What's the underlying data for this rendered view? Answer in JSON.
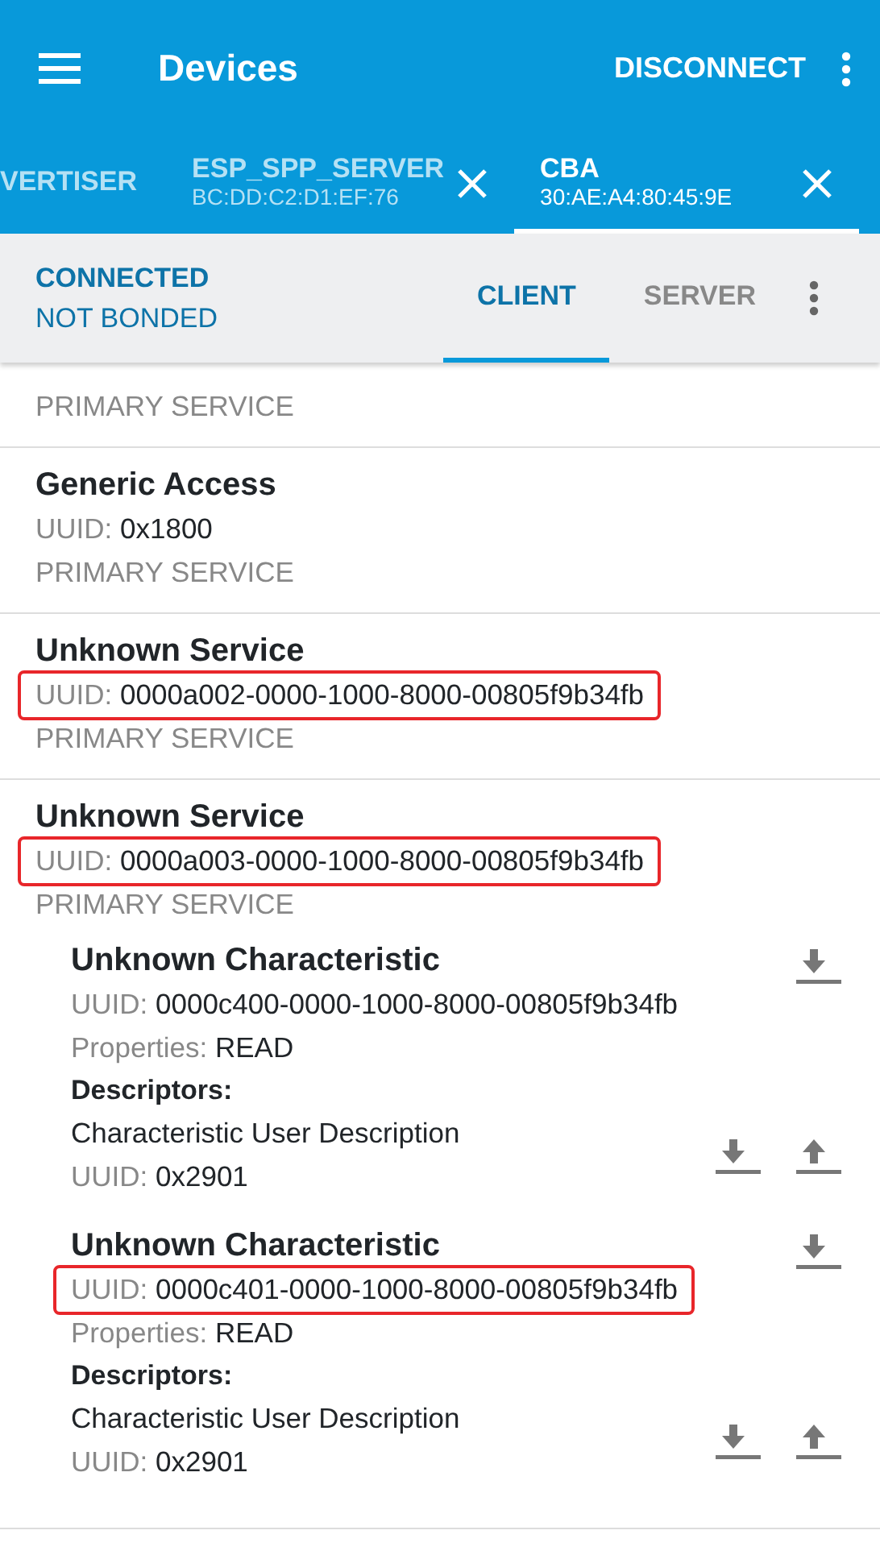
{
  "app_bar": {
    "title": "Devices",
    "action": "DISCONNECT"
  },
  "device_tabs": [
    {
      "name": "VERTISER",
      "selected": false
    },
    {
      "name": "ESP_SPP_SERVER",
      "address": "BC:DD:C2:D1:EF:76",
      "selected": false
    },
    {
      "name": "CBA",
      "address": "30:AE:A4:80:45:9E",
      "selected": true
    }
  ],
  "connection": {
    "state": "CONNECTED",
    "bond": "NOT BONDED"
  },
  "view_tabs": [
    {
      "label": "CLIENT",
      "selected": true
    },
    {
      "label": "SERVER",
      "selected": false
    }
  ],
  "services": [
    {
      "type": "PRIMARY SERVICE"
    },
    {
      "name": "Generic Access",
      "uuid_label": "UUID:",
      "uuid": "0x1800",
      "type": "PRIMARY SERVICE",
      "highlighted": false
    },
    {
      "name": "Unknown Service",
      "uuid_label": "UUID:",
      "uuid": "0000a002-0000-1000-8000-00805f9b34fb",
      "type": "PRIMARY SERVICE",
      "highlighted": true
    },
    {
      "name": "Unknown Service",
      "uuid_label": "UUID:",
      "uuid": "0000a003-0000-1000-8000-00805f9b34fb",
      "type": "PRIMARY SERVICE",
      "highlighted": true,
      "characteristics": [
        {
          "name": "Unknown Characteristic",
          "uuid_label": "UUID:",
          "uuid": "0000c400-0000-1000-8000-00805f9b34fb",
          "highlighted": false,
          "properties_label": "Properties:",
          "properties": "READ",
          "descriptors_label": "Descriptors:",
          "descriptors": [
            {
              "name": "Characteristic User Description",
              "uuid_label": "UUID:",
              "uuid": "0x2901"
            }
          ]
        },
        {
          "name": "Unknown Characteristic",
          "uuid_label": "UUID:",
          "uuid": "0000c401-0000-1000-8000-00805f9b34fb",
          "highlighted": true,
          "properties_label": "Properties:",
          "properties": "READ",
          "descriptors_label": "Descriptors:",
          "descriptors": [
            {
              "name": "Characteristic User Description",
              "uuid_label": "UUID:",
              "uuid": "0x2901"
            }
          ]
        }
      ]
    }
  ]
}
